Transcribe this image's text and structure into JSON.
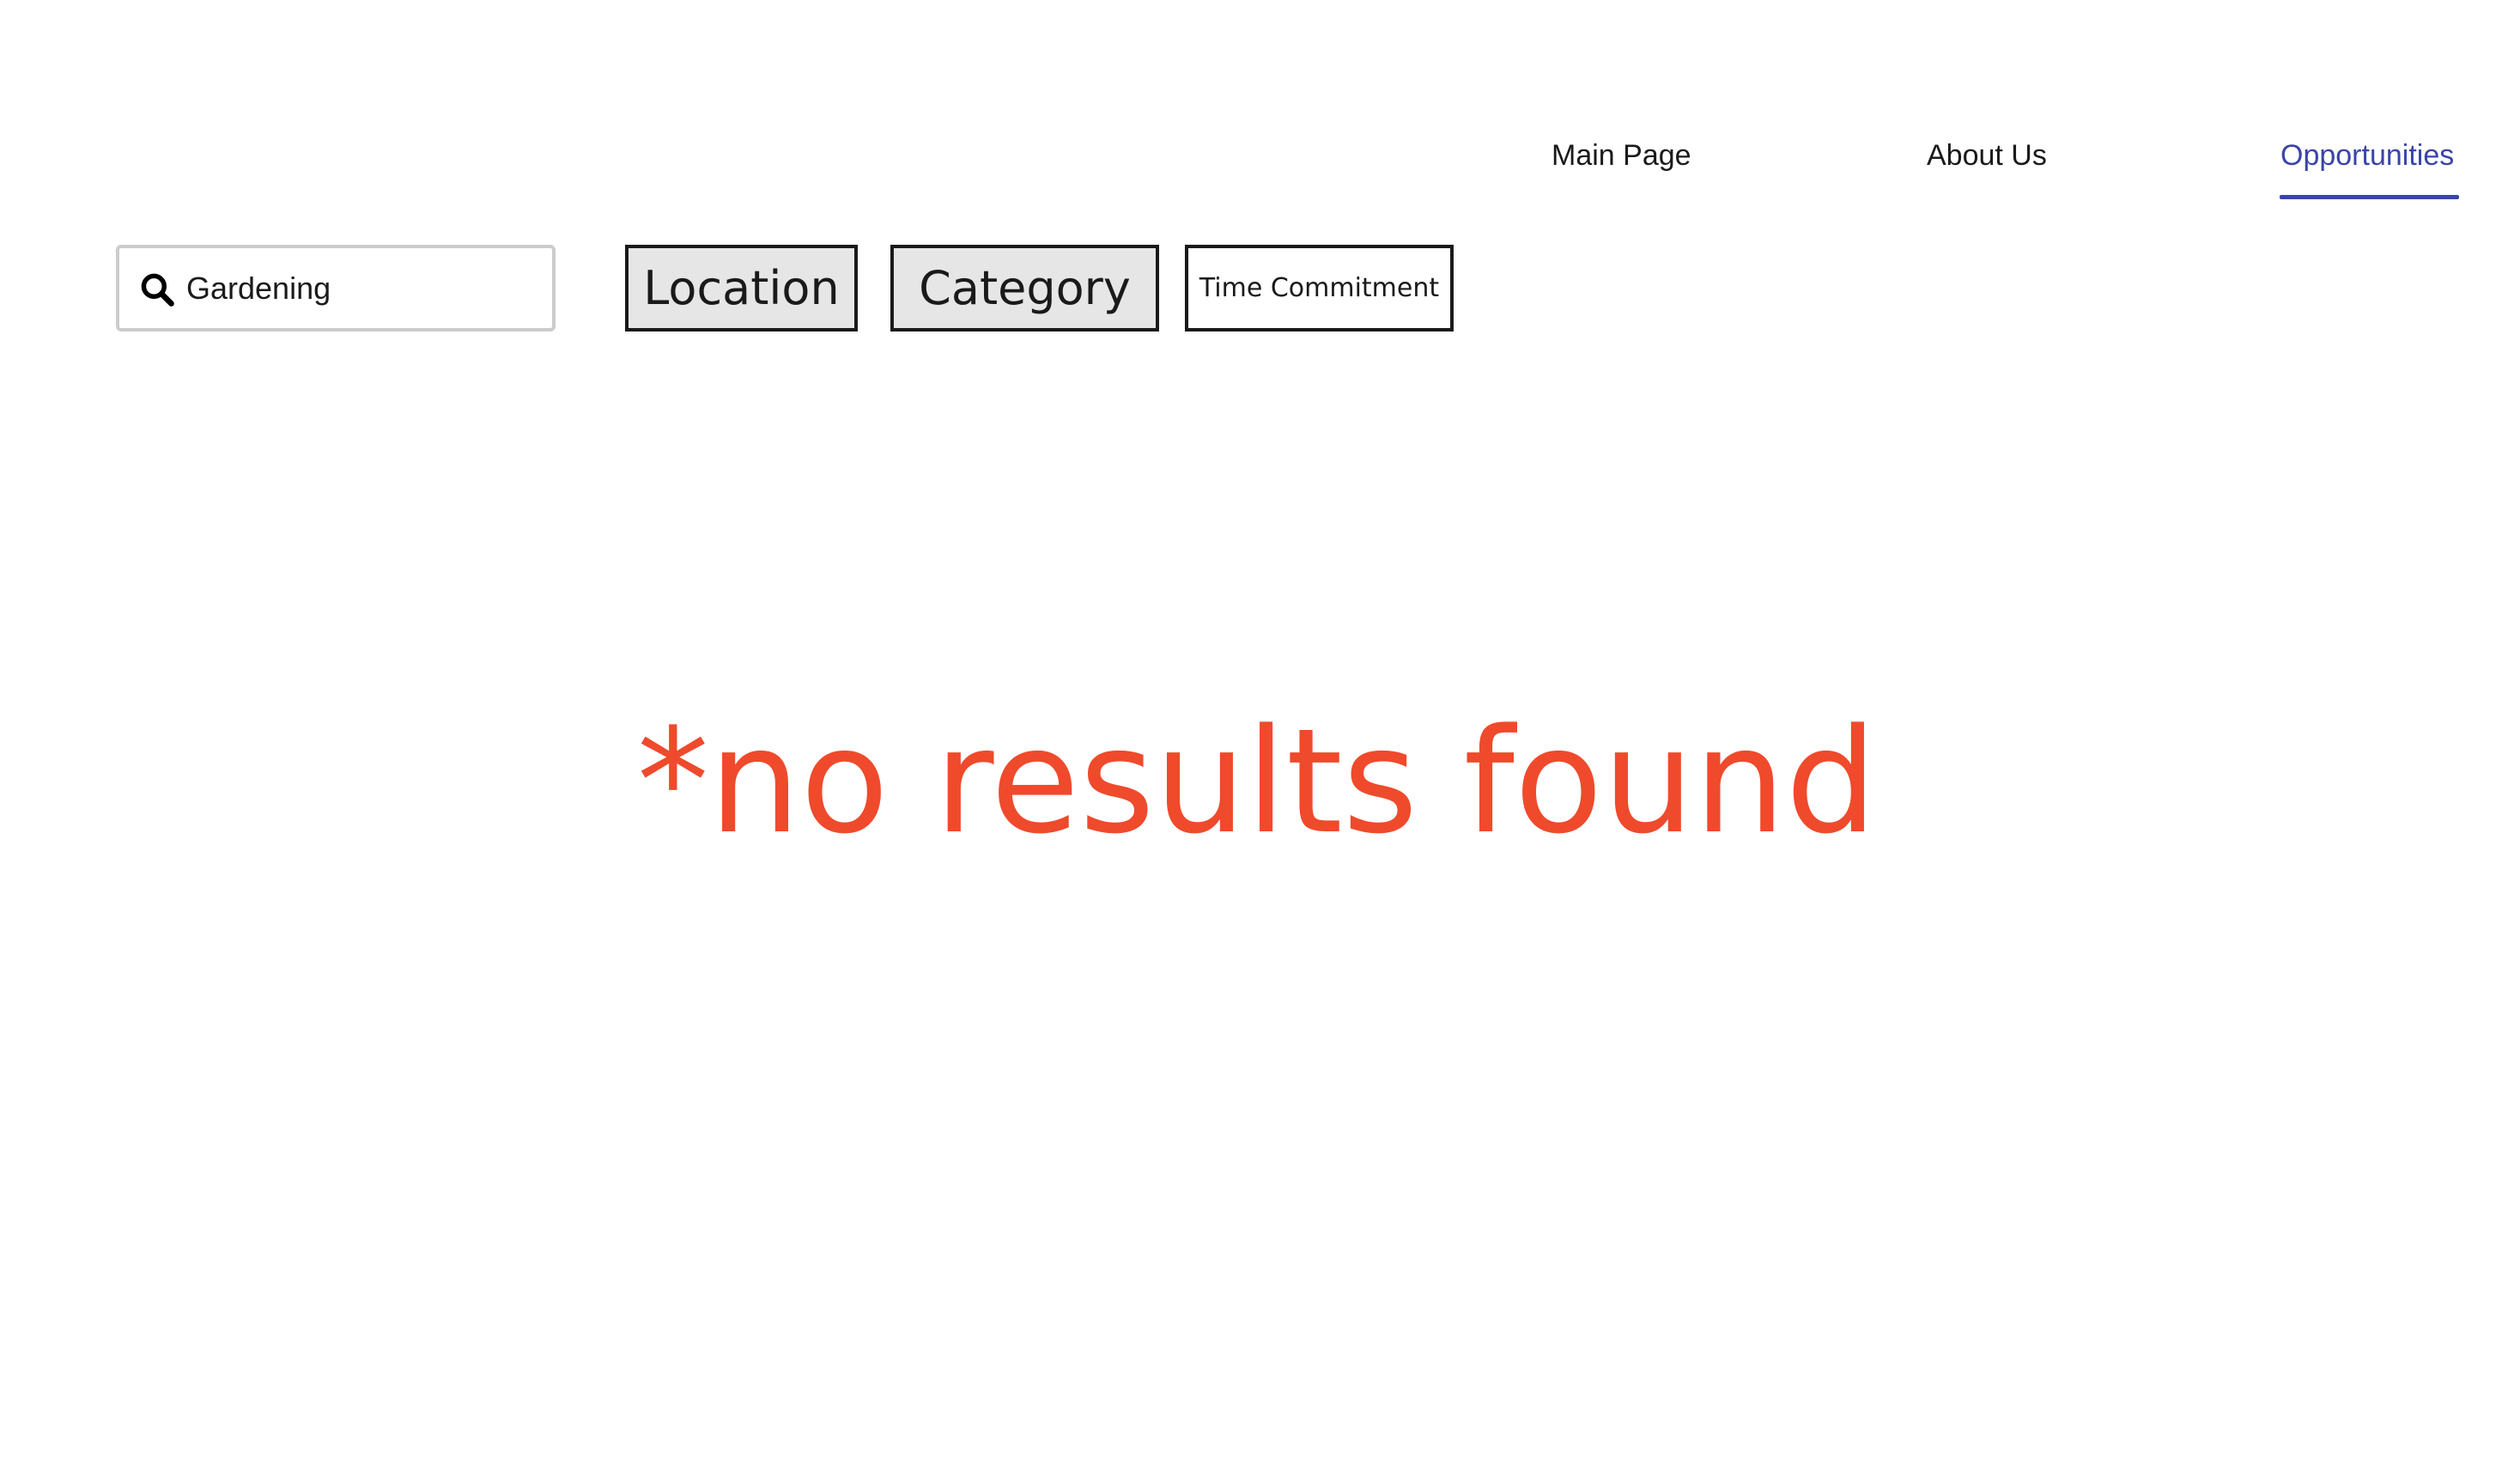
{
  "nav": {
    "items": [
      {
        "label": "Main Page",
        "active": false
      },
      {
        "label": "About Us",
        "active": false
      },
      {
        "label": "Opportunities",
        "active": true
      }
    ],
    "active_color": "#3a45a8"
  },
  "search": {
    "icon": "search-icon",
    "value": "Gardening"
  },
  "filters": {
    "location_label": "Location",
    "category_label": "Category",
    "time_label": "Time Commitment"
  },
  "results": {
    "message": "*no results found",
    "message_color": "#ef4a2c"
  }
}
